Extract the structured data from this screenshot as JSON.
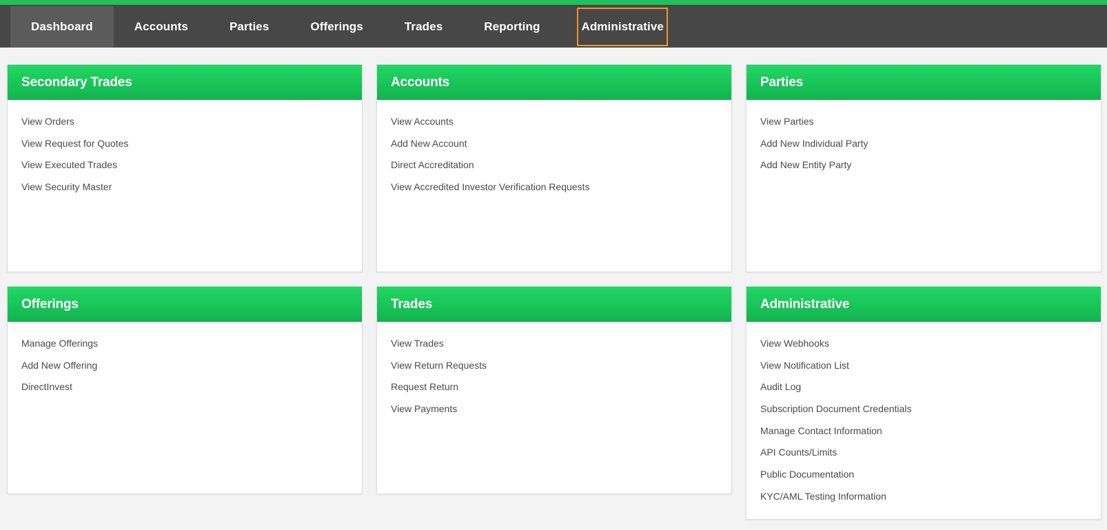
{
  "nav": {
    "items": [
      {
        "label": "Dashboard"
      },
      {
        "label": "Accounts"
      },
      {
        "label": "Parties"
      },
      {
        "label": "Offerings"
      },
      {
        "label": "Trades"
      },
      {
        "label": "Reporting"
      },
      {
        "label": "Administrative"
      }
    ]
  },
  "panels": [
    {
      "title": "Secondary Trades",
      "links": [
        "View Orders",
        "View Request for Quotes",
        "View Executed Trades",
        "View Security Master"
      ]
    },
    {
      "title": "Accounts",
      "links": [
        "View Accounts",
        "Add New Account",
        "Direct Accreditation",
        "View Accredited Investor Verification Requests"
      ]
    },
    {
      "title": "Parties",
      "links": [
        "View Parties",
        "Add New Individual Party",
        "Add New Entity Party"
      ]
    },
    {
      "title": "Offerings",
      "links": [
        "Manage Offerings",
        "Add New Offering",
        "DirectInvest"
      ]
    },
    {
      "title": "Trades",
      "links": [
        "View Trades",
        "View Return Requests",
        "Request Return",
        "View Payments"
      ]
    },
    {
      "title": "Administrative",
      "links": [
        "View Webhooks",
        "View Notification List",
        "Audit Log",
        "Subscription Document Credentials",
        "Manage Contact Information",
        "API Counts/Limits",
        "Public Documentation",
        "KYC/AML Testing Information"
      ]
    }
  ],
  "colors": {
    "accent_green": "#1fc25a",
    "nav_background": "#474747",
    "highlight_outline": "#f5961f"
  }
}
